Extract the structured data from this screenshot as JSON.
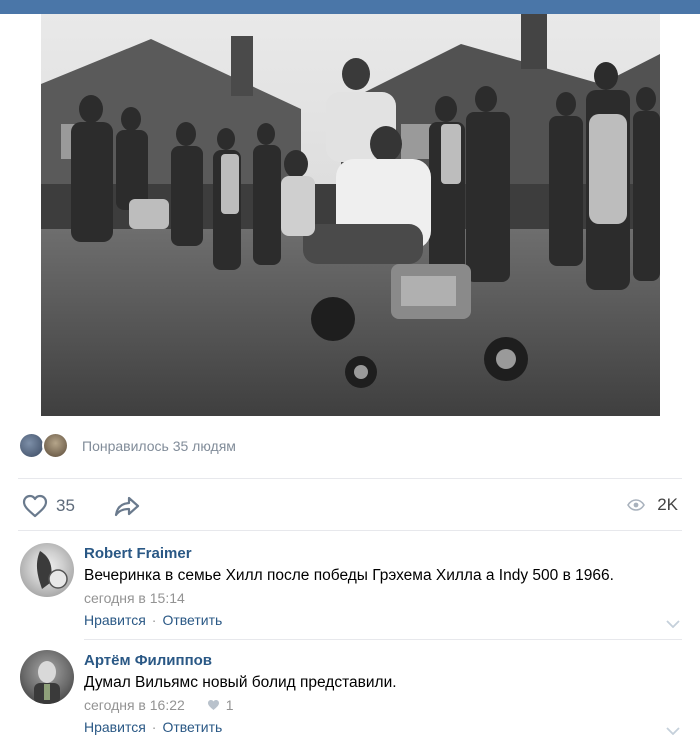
{
  "post": {
    "photo_alt_icon": "photo",
    "likes_summary": "Понравилось 35 людям",
    "like_count": "35",
    "views_count": "2K"
  },
  "comments": [
    {
      "author": "Robert Fraimer",
      "text": "Вечеринка в семье Хилл после победы Грэхема Хилла а Indy 500 в 1966.",
      "time": "сегодня в 15:14",
      "likes": "",
      "like_label": "Нравится",
      "reply_label": "Ответить"
    },
    {
      "author": "Артём Филиппов",
      "text": "Думал Вильямс новый болид представили.",
      "time": "сегодня в 16:22",
      "likes": "1",
      "like_label": "Нравится",
      "reply_label": "Ответить"
    }
  ],
  "colors": {
    "header": "#4a76a8",
    "link": "#2a5885",
    "muted": "#818c99",
    "icon": "#5d6a7a"
  },
  "icons": [
    "heart-icon",
    "share-icon",
    "eye-icon",
    "chevron-down-icon"
  ]
}
